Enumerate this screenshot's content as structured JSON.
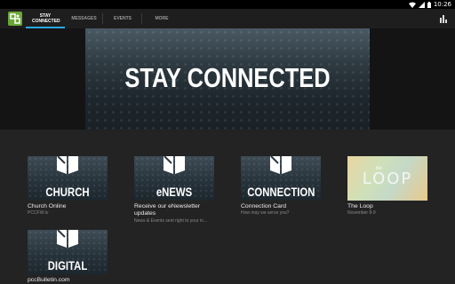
{
  "status_bar": {
    "time": "10:26"
  },
  "tabs": [
    {
      "label": "STAY CONNECTED",
      "active": true
    },
    {
      "label": "MESSAGES",
      "active": false
    },
    {
      "label": "EVENTS",
      "active": false
    },
    {
      "label": "MORE",
      "active": false
    }
  ],
  "hero": {
    "title": "STAY CONNECTED"
  },
  "cards": [
    {
      "thumb_text": "CHURCH",
      "title": "Church Online",
      "subtitle": "PCCFW.tv"
    },
    {
      "thumb_text": "eNEWS",
      "title": "Receive our eNewsletter updates",
      "subtitle": "News & Events sent right to your in..."
    },
    {
      "thumb_text": "CONNECTION",
      "title": "Connection Card",
      "subtitle": "How may we serve you?"
    },
    {
      "thumb_text": "LOOP",
      "thumb_small": "the",
      "title": "The Loop",
      "subtitle": "November 8-9"
    },
    {
      "thumb_text": "DIGITAL",
      "title": "pccBulletin.com",
      "subtitle": ""
    }
  ],
  "colors": {
    "accent": "#29a8e0",
    "logo": "#6aa639"
  }
}
